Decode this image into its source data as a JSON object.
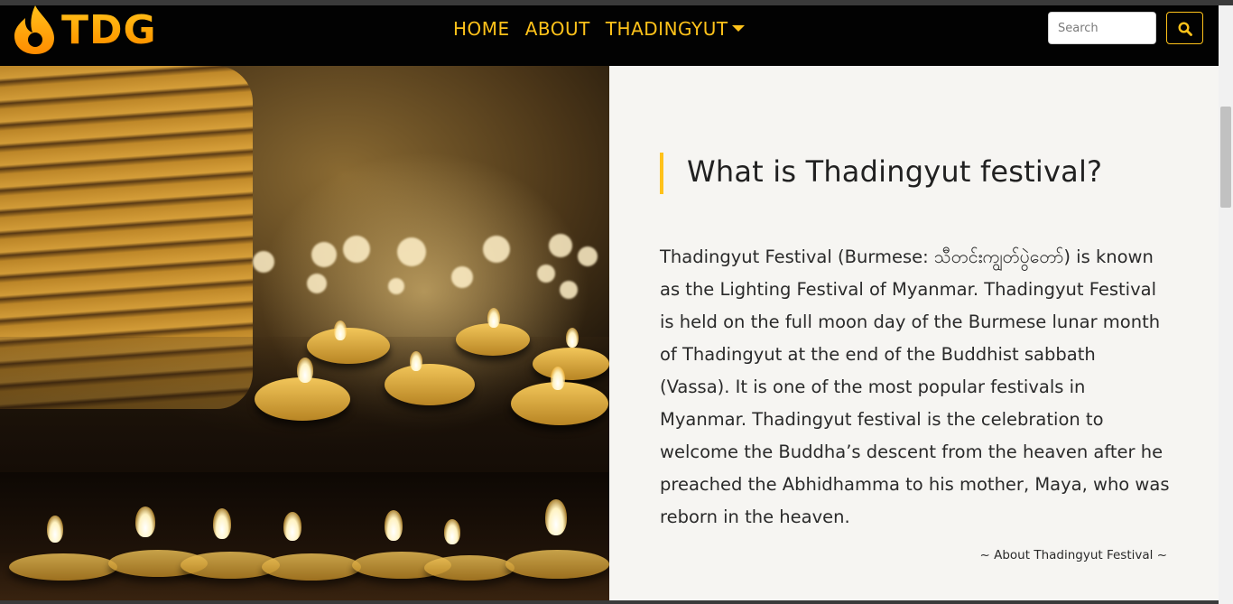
{
  "brand": {
    "name": "TDG",
    "logo_icon": "flame-drop-icon",
    "accent_color": "#ffc21a"
  },
  "nav": {
    "items": [
      {
        "label": "HOME"
      },
      {
        "label": "ABOUT"
      },
      {
        "label": "THADINGYUT",
        "has_dropdown": true
      }
    ]
  },
  "search": {
    "placeholder": "Search",
    "value": "",
    "button_icon": "search-icon"
  },
  "images": {
    "top": {
      "subject": "candles-and-lantern-photo"
    },
    "bottom": {
      "subject": "row-of-candles-photo"
    }
  },
  "article": {
    "title": "What is Thadingyut festival?",
    "body": "Thadingyut Festival (Burmese: သီတင်းကျွတ်ပွဲတော်) is known as the Lighting Festival of Myanmar. Thadingyut Festival is held on the full moon day of the Burmese lunar month of Thadingyut at the end of the Buddhist sabbath (Vassa). It is one of the most popular festivals in Myanmar. Thadingyut festival is the celebration to welcome the Buddha’s descent from the heaven after he preached the Abhidhamma to his mother, Maya, who was reborn in the heaven.",
    "caption": "~ About Thadingyut Festival ~"
  }
}
